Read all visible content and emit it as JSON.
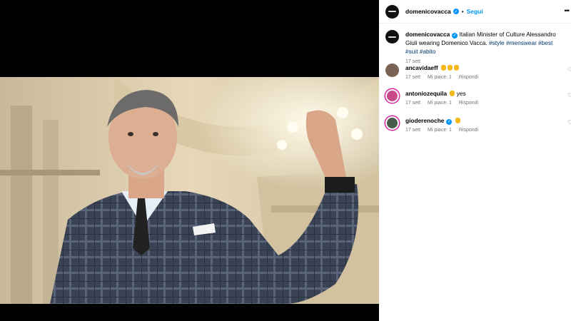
{
  "header": {
    "username": "domenicovacca",
    "separator": "•",
    "follow_label": "Segui",
    "more_icon": "more-options-icon"
  },
  "caption": {
    "username": "domenicovacca",
    "text": "Italian Minister of Culture Alessandro Giuli wearing Domenico Vacca.",
    "hashtags": "#style #menswear #best #suit #abito",
    "date": "17 sett"
  },
  "comments": [
    {
      "username": "ancavidaeff",
      "text": "",
      "emoji": "clapping-hands x3",
      "date": "17 sett",
      "likes": "Mi piace: 1",
      "reply": "Rispondi"
    },
    {
      "username": "antoniozequila",
      "text": "yes",
      "emoji": "clapping-hands",
      "date": "17 sett",
      "likes": "Mi piace: 1",
      "reply": "Rispondi"
    },
    {
      "username": "gioderenoche",
      "text": "",
      "emoji": "clapping-hands",
      "date": "17 sett",
      "likes": "Mi piace: 1",
      "reply": "Rispondi"
    }
  ],
  "colors": {
    "link": "#0095f6",
    "hashtag": "#00376b",
    "meta": "#737373"
  }
}
